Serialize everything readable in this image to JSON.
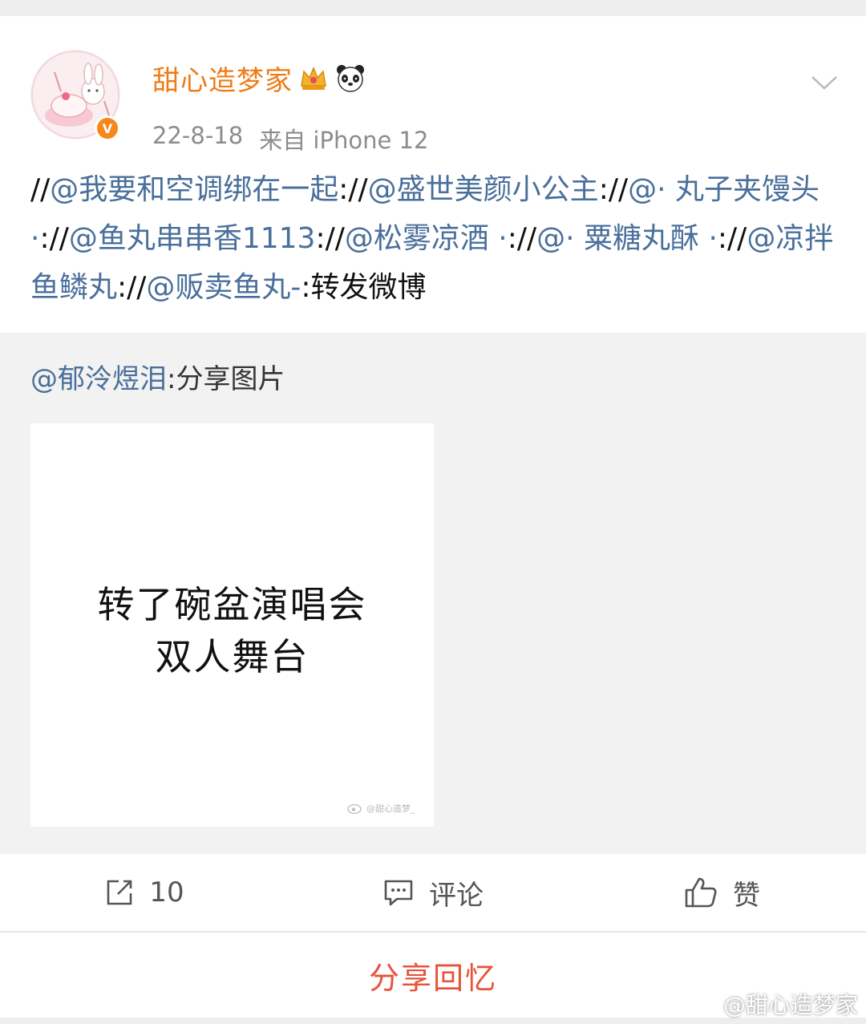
{
  "post": {
    "username": "甜心造梦家",
    "badges": [
      "crown-icon",
      "panda-icon"
    ],
    "date": "22-8-18",
    "source": "来自 iPhone 12",
    "repost_chain": [
      {
        "sep": "//",
        "mention": "@我要和空调绑在一起"
      },
      {
        "sep": "://",
        "mention": "@盛世美颜小公主"
      },
      {
        "sep": "://",
        "mention": "@· 丸子夹馒头 ·"
      },
      {
        "sep": "://",
        "mention": "@鱼丸串串香1113"
      },
      {
        "sep": "://",
        "mention": "@松雾凉酒 ·"
      },
      {
        "sep": "://",
        "mention": "@· 粟糖丸酥 ·"
      },
      {
        "sep": "://",
        "mention": "@凉拌鱼鳞丸"
      },
      {
        "sep": "://",
        "mention": "@贩卖鱼丸-"
      }
    ],
    "repost_tail": ":转发微博"
  },
  "quoted": {
    "author": "@郁泠煜泪",
    "text": ":分享图片",
    "image_line1": "转了碗盆演唱会",
    "image_line2": "双人舞台",
    "image_watermark": "@甜心造梦_"
  },
  "actions": {
    "repost_count": "10",
    "comment_label": "评论",
    "like_label": "赞"
  },
  "share_label": "分享回忆",
  "corner_watermark": "@甜心造梦家",
  "colors": {
    "username": "#ef7b16",
    "mention": "#4a6f9b",
    "share": "#e8533b",
    "verified": "#f7861b"
  }
}
